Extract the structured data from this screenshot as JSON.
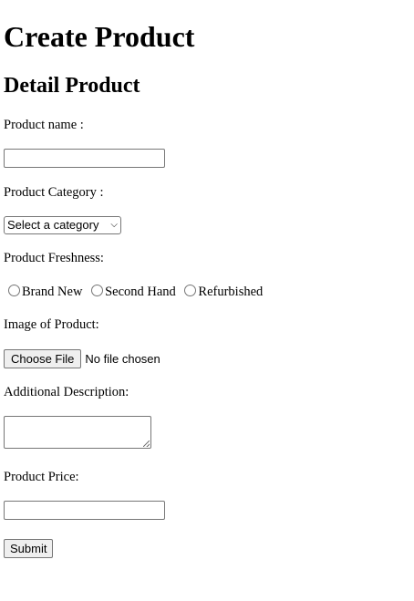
{
  "page": {
    "title": "Create Product",
    "section_title": "Detail Product"
  },
  "form": {
    "product_name": {
      "label": "Product name :",
      "value": ""
    },
    "product_category": {
      "label": "Product Category :",
      "selected": "Select a category"
    },
    "product_freshness": {
      "label": "Product Freshness:",
      "options": [
        "Brand New",
        "Second Hand",
        "Refurbished"
      ],
      "selected_index": null
    },
    "product_image": {
      "label": "Image of Product:",
      "button_label": "Choose File",
      "status": "No file chosen"
    },
    "additional_description": {
      "label": "Additional Description:",
      "value": ""
    },
    "product_price": {
      "label": "Product Price:",
      "value": ""
    },
    "submit_label": "Submit"
  },
  "icons": {
    "select_chevron": "chevron-down-icon"
  },
  "colors": {
    "text": "#000000",
    "control_border": "#767676",
    "button_background": "#efefef",
    "background": "#ffffff"
  }
}
